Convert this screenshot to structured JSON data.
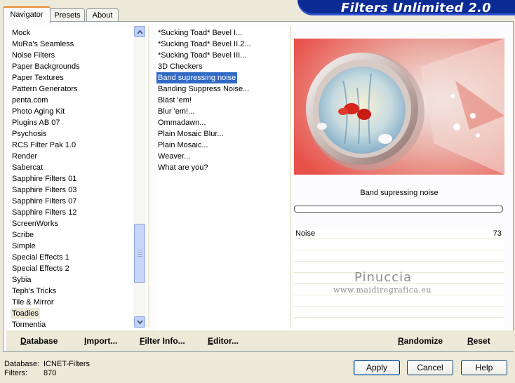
{
  "tabs": [
    "Navigator",
    "Presets",
    "About"
  ],
  "app_title": "Filters Unlimited 2.0",
  "categories": [
    "Mock",
    "MuRa's Seamless",
    "Noise Filters",
    "Paper Backgrounds",
    "Paper Textures",
    "Pattern Generators",
    "penta.com",
    "Photo Aging Kit",
    "Plugins AB 07",
    "Psychosis",
    "RCS Filter Pak 1.0",
    "Render",
    "Sabercat",
    "Sapphire Filters 01",
    "Sapphire Filters 03",
    "Sapphire Filters 07",
    "Sapphire Filters 12",
    "ScreenWorks",
    "Scribe",
    "Simple",
    "Special Effects 1",
    "Special Effects 2",
    "Sybia",
    "Teph's Tricks",
    "Tile & Mirror",
    "Toadies",
    "Tormentia"
  ],
  "selected_category": "Toadies",
  "filters": [
    "*Sucking Toad*  Bevel I...",
    "*Sucking Toad*  Bevel II.2...",
    "*Sucking Toad*  Bevel III...",
    "3D Checkers",
    "Band supressing noise",
    "Banding Suppress Noise...",
    "Blast 'em!",
    "Blur 'em!...",
    "Ommadawn...",
    "Plain Mosaic Blur...",
    "Plain Mosaic...",
    "Weaver...",
    "What are you?"
  ],
  "selected_filter": "Band supressing noise",
  "filter_name": "Band supressing noise",
  "progress": 0,
  "params": [
    {
      "name": "Noise",
      "value": "73"
    }
  ],
  "watermark": {
    "line1": "Pinuccia",
    "line2": "www.maidiregrafica.eu"
  },
  "toolbar": {
    "database": {
      "u": "D",
      "rest": "atabase"
    },
    "import": {
      "u": "I",
      "rest": "mport..."
    },
    "filter_info": {
      "u": "F",
      "rest": "ilter Info..."
    },
    "editor": {
      "u": "E",
      "rest": "ditor..."
    },
    "randomize": {
      "u": "R",
      "rest": "andomize"
    },
    "reset": {
      "u": "R",
      "rest": "eset"
    }
  },
  "status": {
    "database_label": "Database:",
    "database_value": "ICNET-Filters",
    "filters_label": "Filters:",
    "filters_value": "870"
  },
  "buttons": {
    "apply": "Apply",
    "cancel": "Cancel",
    "help": "Help"
  },
  "colors": {
    "selection": "#316ac5",
    "banner": "#0b2a94",
    "preview_red": "#e8514a"
  }
}
